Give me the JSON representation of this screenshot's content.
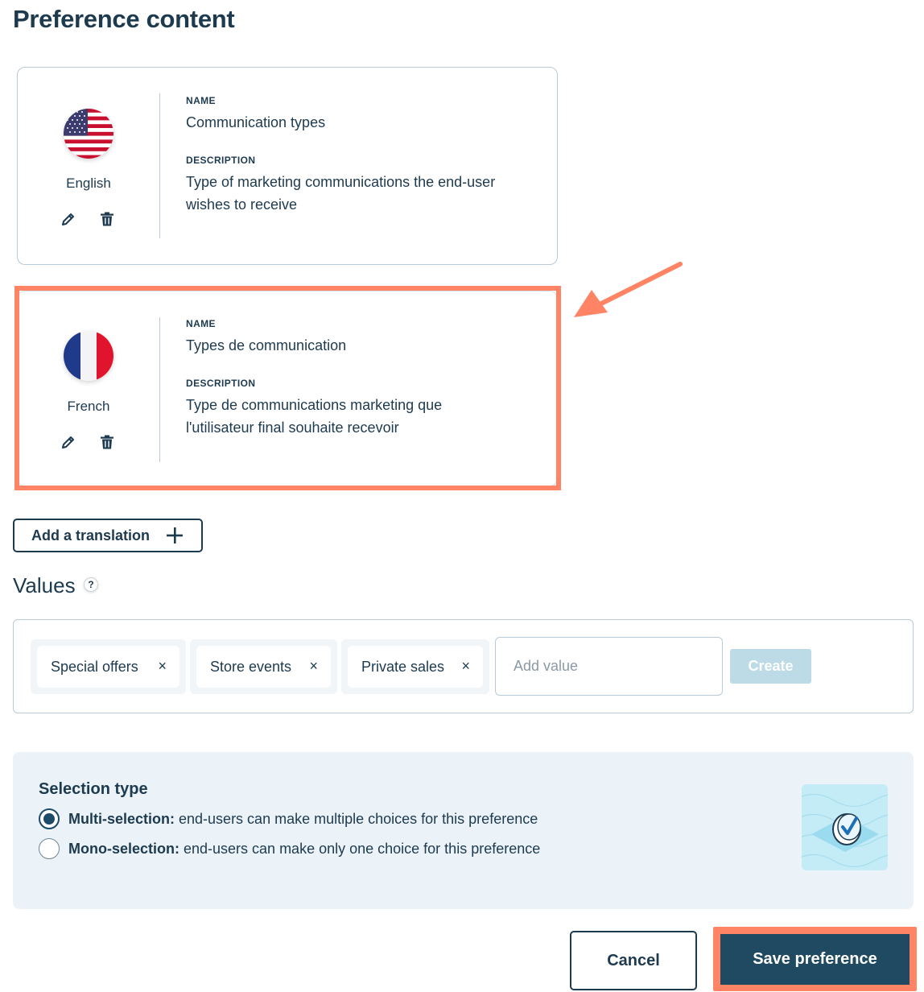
{
  "page": {
    "title": "Preference content"
  },
  "translations": [
    {
      "language": "English",
      "flag_icon": "us-flag-icon",
      "name_label": "NAME",
      "name": "Communication types",
      "description_label": "DESCRIPTION",
      "description_line1": "Type of marketing communications the end-user",
      "description_line2": "wishes to receive"
    },
    {
      "language": "French",
      "flag_icon": "france-flag-icon",
      "name_label": "NAME",
      "name": "Types de communication",
      "description_label": "DESCRIPTION",
      "description_line1": "Type de communications marketing que",
      "description_line2": "l'utilisateur final souhaite recevoir"
    }
  ],
  "add_translation": {
    "label": "Add a translation",
    "icon": "plus-icon"
  },
  "values": {
    "title": "Values",
    "help_icon": "?",
    "tags": [
      "Special offers",
      "Store events",
      "Private sales"
    ],
    "remove_glyph": "×",
    "input_placeholder": "Add value",
    "create_label": "Create"
  },
  "selection": {
    "title": "Selection type",
    "options": [
      {
        "bold": "Multi-selection:",
        "text": " end-users can make multiple choices for this preference",
        "selected": true
      },
      {
        "bold": "Mono-selection:",
        "text": " end-users can make only one choice for this preference",
        "selected": false
      }
    ]
  },
  "footer": {
    "cancel_label": "Cancel",
    "save_label": "Save preference"
  },
  "colors": {
    "primary": "#1f4a62",
    "highlight": "#ff8466",
    "panel": "#ebf3f9",
    "create_disabled": "#bcdbe6"
  }
}
